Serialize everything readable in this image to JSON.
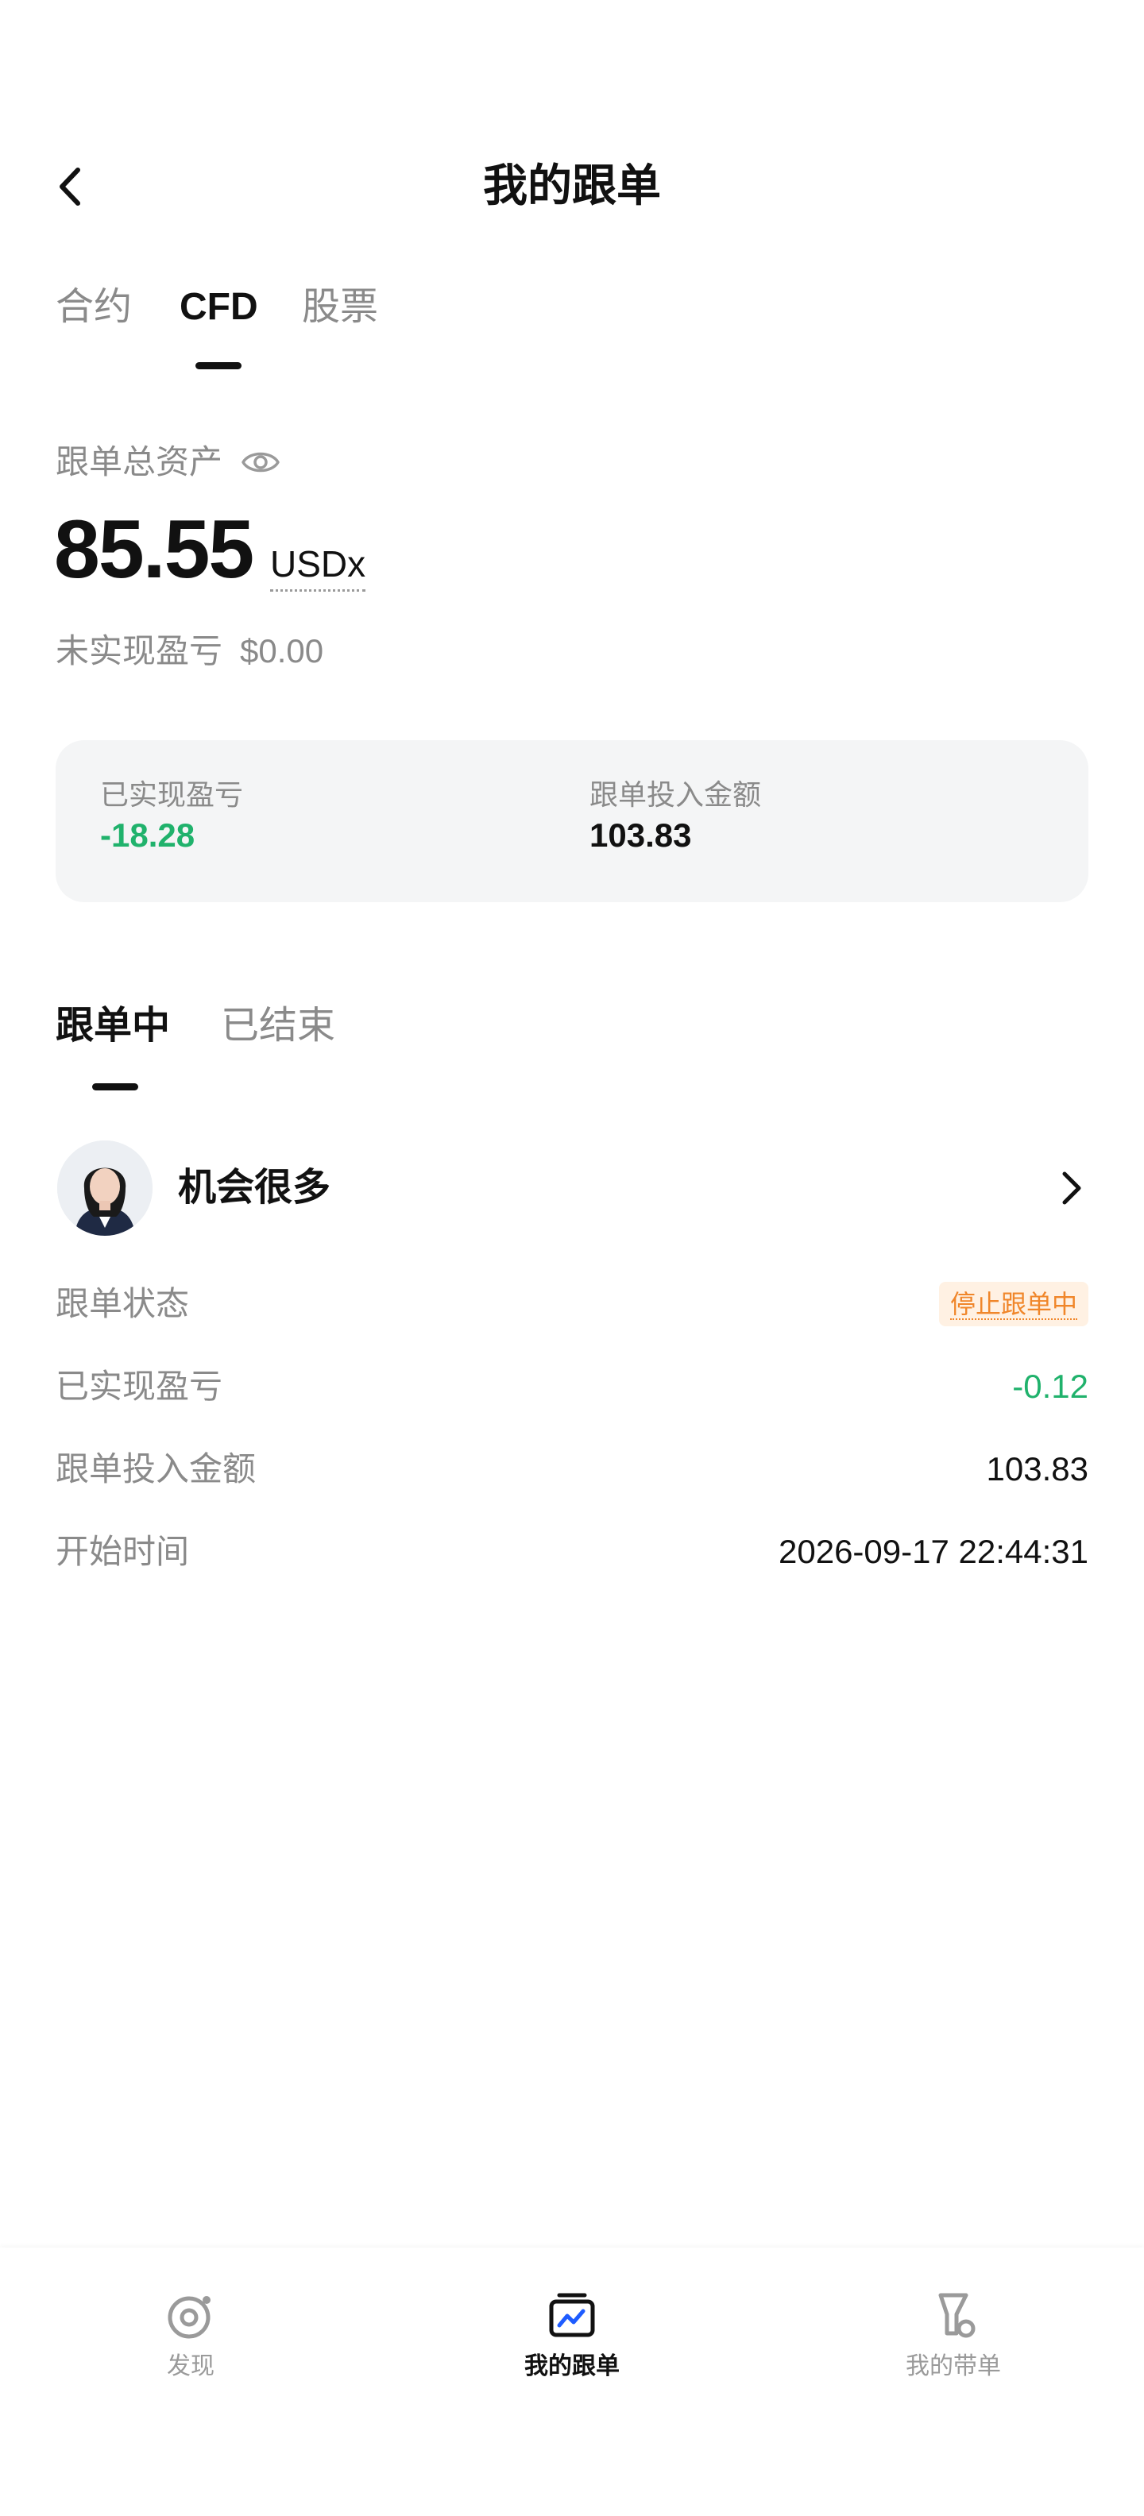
{
  "header": {
    "title": "我的跟单"
  },
  "category_tabs": [
    {
      "label": "合约",
      "active": false
    },
    {
      "label": "CFD",
      "active": true
    },
    {
      "label": "股票",
      "active": false
    }
  ],
  "assets": {
    "label": "跟单总资产",
    "value": "85.55",
    "unit": "USDx",
    "unrealized_label": "未实现盈亏",
    "unrealized_value": "$0.00"
  },
  "summary": {
    "realized_label": "已实现盈亏",
    "realized_value": "-18.28",
    "invested_label": "跟单投入金额",
    "invested_value": "103.83"
  },
  "status_tabs": [
    {
      "label": "跟单中",
      "active": true
    },
    {
      "label": "已结束",
      "active": false
    }
  ],
  "trader": {
    "name": "机会很多",
    "rows": {
      "status_label": "跟单状态",
      "status_value": "停止跟单中",
      "realized_label": "已实现盈亏",
      "realized_value": "-0.12",
      "invested_label": "跟单投入金额",
      "invested_value": "103.83",
      "start_label": "开始时间",
      "start_value": "2026-09-17 22:44:31"
    }
  },
  "bottom_nav": [
    {
      "label": "发现",
      "icon": "discover-icon",
      "active": false
    },
    {
      "label": "我的跟单",
      "icon": "copy-trade-icon",
      "active": true
    },
    {
      "label": "我的带单",
      "icon": "lead-trade-icon",
      "active": false
    }
  ],
  "colors": {
    "profit_green": "#20b26c",
    "badge_orange": "#f0862a",
    "badge_bg": "#fff1e3",
    "accent_blue": "#1e5cff"
  }
}
